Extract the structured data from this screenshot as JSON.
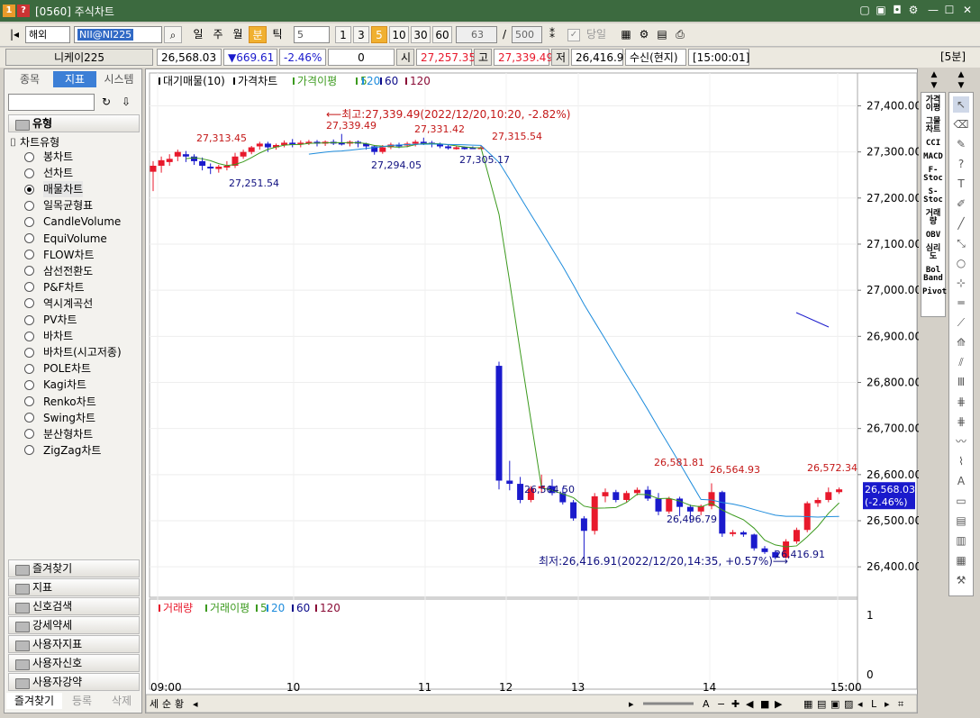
{
  "window": {
    "icon1": "1",
    "icon2": "?",
    "title": "[0560] 주식차트"
  },
  "toolbar": {
    "market": "해외",
    "symbol": "NII@NI225",
    "periods": [
      "일",
      "주",
      "월",
      "분",
      "틱"
    ],
    "interval_value": "5",
    "intervals": [
      "1",
      "3",
      "5",
      "10",
      "30",
      "60"
    ],
    "count_value": "63",
    "count_max": "500",
    "today_label": "당일"
  },
  "quote": {
    "name": "니케이225",
    "last": "26,568.03",
    "change": "▼669.61",
    "change_pct": "-2.46%",
    "volume": "0",
    "open_label": "시",
    "open": "27,257.35",
    "high_label": "고",
    "high": "27,339.49",
    "low_label": "저",
    "low": "26,416.91",
    "status": "수신(현지)",
    "time": "[15:00:01]",
    "interval_badge": "[5분]"
  },
  "left_panel": {
    "tabs": [
      "종목",
      "지표",
      "시스템"
    ],
    "section": "유형",
    "tree_root": "차트유형",
    "chart_types": [
      "봉차트",
      "선차트",
      "매물차트",
      "일목균형표",
      "CandleVolume",
      "EquiVolume",
      "FLOW차트",
      "삼선전환도",
      "P&F차트",
      "역시계곡선",
      "PV차트",
      "바차트",
      "바차트(시고저종)",
      "POLE차트",
      "Kagi차트",
      "Renko차트",
      "Swing차트",
      "분산형차트",
      "ZigZag차트"
    ],
    "folders": [
      "즐겨찾기",
      "지표",
      "신호검색",
      "강세약세",
      "사용자지표",
      "사용자신호",
      "사용자강약"
    ],
    "bottom_tabs": [
      "즐겨찾기",
      "등록",
      "삭제"
    ]
  },
  "side_indicators": [
    "가격이평",
    "그물차트",
    "CCI",
    "MACD",
    "F-Stoc",
    "S-Stoc",
    "거래량",
    "OBV",
    "심리도",
    "Bol Band",
    "Pivot"
  ],
  "colors": {
    "up": "#e8192c",
    "down": "#1a1acc",
    "ma5": "#3c9a1e",
    "ma20": "#1e8cdc",
    "ma60": "#0c0c8a",
    "ma120": "#8a0c36",
    "title_green": "#3c6a3f"
  },
  "chart_data": {
    "type": "candlestick",
    "legend_main": [
      "대기매물(10)",
      "가격차트",
      "가격이평",
      "5",
      "20",
      "60",
      "120"
    ],
    "legend_volume": [
      "거래량",
      "거래이평",
      "5",
      "20",
      "60",
      "120"
    ],
    "x_ticks": [
      "09:00",
      "10",
      "11",
      "12",
      "13",
      "14",
      "15:00"
    ],
    "y_ticks": [
      27400,
      27300,
      27200,
      27100,
      27000,
      26900,
      26800,
      26700,
      26600,
      26500,
      26400
    ],
    "y_tick_labels": [
      "27,400.00",
      "27,300.00",
      "27,200.00",
      "27,100.00",
      "27,000.00",
      "26,900.00",
      "26,800.00",
      "26,700.00",
      "26,600.00",
      "26,500.00",
      "26,400.00"
    ],
    "ylim": [
      26330,
      27440
    ],
    "volume_ticks": [
      "1",
      "0"
    ],
    "annotations": {
      "high_note": "최고:27,339.49(2022/12/20,10:20, -2.82%)",
      "low_note": "최저:26,416.91(2022/12/20,14:35, +0.57%)",
      "labels": [
        "27,313.45",
        "27,339.49",
        "27,331.42",
        "27,315.54",
        "27,251.54",
        "27,294.05",
        "27,305.17",
        "26,581.81",
        "26,564.93",
        "26,572.34",
        "26,564.50",
        "26,496.79",
        "26,416.91"
      ]
    },
    "current_price": "26,568.03",
    "current_pct": "(-2.46%)",
    "candles": [
      [
        27257,
        27270,
        27215,
        27280
      ],
      [
        27270,
        27282,
        27255,
        27290
      ],
      [
        27278,
        27285,
        27270,
        27295
      ],
      [
        27290,
        27300,
        27280,
        27305
      ],
      [
        27295,
        27290,
        27278,
        27302
      ],
      [
        27290,
        27280,
        27272,
        27295
      ],
      [
        27280,
        27270,
        27260,
        27288
      ],
      [
        27268,
        27265,
        27252,
        27275
      ],
      [
        27263,
        27268,
        27255,
        27272
      ],
      [
        27268,
        27270,
        27260,
        27280
      ],
      [
        27270,
        27290,
        27265,
        27298
      ],
      [
        27290,
        27300,
        27285,
        27305
      ],
      [
        27300,
        27310,
        27295,
        27313
      ],
      [
        27312,
        27318,
        27305,
        27322
      ],
      [
        27318,
        27310,
        27300,
        27322
      ],
      [
        27310,
        27315,
        27305,
        27318
      ],
      [
        27315,
        27320,
        27310,
        27325
      ],
      [
        27320,
        27316,
        27310,
        27328
      ],
      [
        27316,
        27320,
        27310,
        27325
      ],
      [
        27320,
        27322,
        27315,
        27326
      ],
      [
        27322,
        27318,
        27312,
        27326
      ],
      [
        27318,
        27322,
        27313,
        27325
      ],
      [
        27322,
        27320,
        27315,
        27327
      ],
      [
        27320,
        27318,
        27314,
        27339
      ],
      [
        27318,
        27322,
        27312,
        27325
      ],
      [
        27322,
        27318,
        27310,
        27325
      ],
      [
        27318,
        27312,
        27305,
        27320
      ],
      [
        27312,
        27300,
        27294,
        27315
      ],
      [
        27300,
        27310,
        27296,
        27315
      ],
      [
        27310,
        27316,
        27306,
        27320
      ],
      [
        27316,
        27314,
        27308,
        27320
      ],
      [
        27314,
        27318,
        27310,
        27322
      ],
      [
        27318,
        27322,
        27312,
        27326
      ],
      [
        27322,
        27320,
        27315,
        27331
      ],
      [
        27320,
        27316,
        27310,
        27324
      ],
      [
        27316,
        27312,
        27308,
        27320
      ],
      [
        27312,
        27308,
        27305,
        27315
      ],
      [
        27308,
        27310,
        27305,
        27313
      ],
      [
        27310,
        27308,
        27305,
        27312
      ],
      [
        27310,
        27309,
        27307,
        27312
      ],
      [
        27309,
        27310,
        27307,
        27315
      ],
      [
        26836,
        26587,
        26568,
        26845
      ],
      [
        26587,
        26580,
        26566,
        26630
      ],
      [
        26580,
        26545,
        26538,
        26595
      ],
      [
        26545,
        26570,
        26540,
        26575
      ],
      [
        26570,
        26575,
        26560,
        26600
      ],
      [
        26575,
        26560,
        26555,
        26590
      ],
      [
        26560,
        26540,
        26535,
        26572
      ],
      [
        26540,
        26505,
        26500,
        26545
      ],
      [
        26505,
        26478,
        26416,
        26510
      ],
      [
        26478,
        26553,
        26470,
        26560
      ],
      [
        26553,
        26562,
        26540,
        26570
      ],
      [
        26562,
        26545,
        26540,
        26567
      ],
      [
        26545,
        26560,
        26540,
        26565
      ],
      [
        26560,
        26567,
        26555,
        26572
      ],
      [
        26567,
        26548,
        26543,
        26575
      ],
      [
        26548,
        26520,
        26512,
        26560
      ],
      [
        26520,
        26548,
        26515,
        26552
      ],
      [
        26548,
        26530,
        26510,
        26552
      ],
      [
        26530,
        26520,
        26496,
        26535
      ],
      [
        26520,
        26532,
        26512,
        26535
      ],
      [
        26532,
        26562,
        26525,
        26581
      ],
      [
        26562,
        26472,
        26465,
        26565
      ],
      [
        26472,
        26475,
        26466,
        26480
      ],
      [
        26475,
        26470,
        26465,
        26478
      ],
      [
        26470,
        26440,
        26435,
        26472
      ],
      [
        26440,
        26432,
        26428,
        26445
      ],
      [
        26432,
        26420,
        26416,
        26436
      ],
      [
        26420,
        26455,
        26418,
        26460
      ],
      [
        26455,
        26480,
        26450,
        26485
      ],
      [
        26480,
        26538,
        26475,
        26542
      ],
      [
        26538,
        26545,
        26530,
        26550
      ],
      [
        26545,
        26562,
        26540,
        26572
      ],
      [
        26562,
        26568,
        26558,
        26572
      ]
    ]
  }
}
